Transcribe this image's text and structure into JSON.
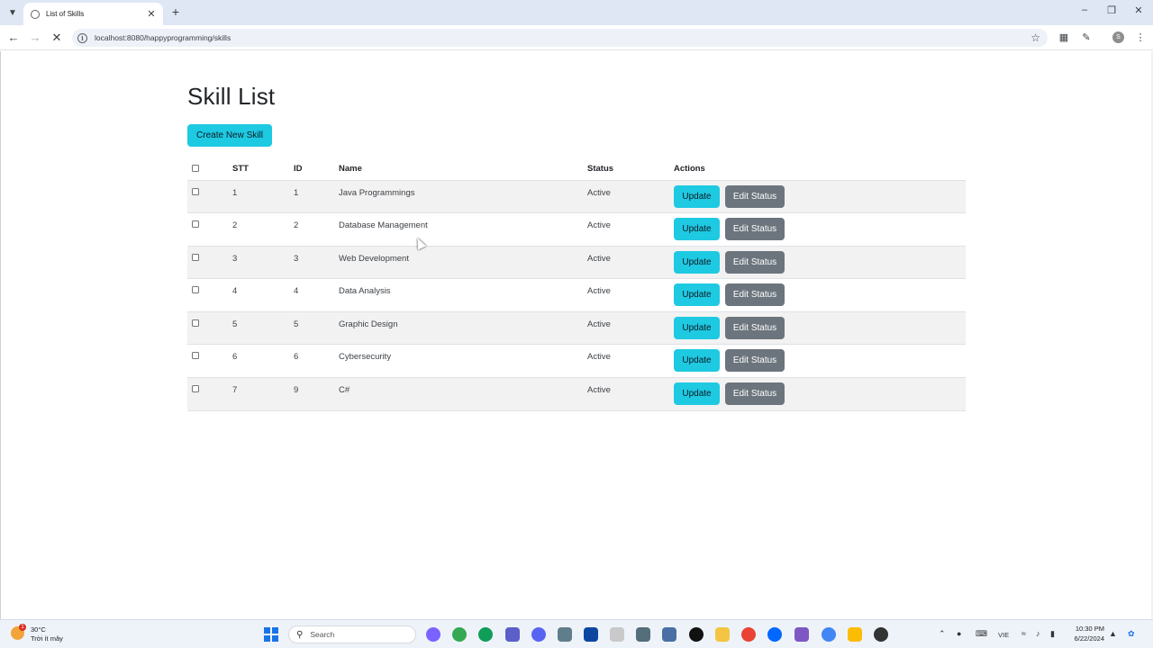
{
  "browser": {
    "tab_title": "List of Skills",
    "url": "localhost:8080/happyprogramming/skills",
    "profile_initial": "S"
  },
  "page": {
    "title": "Skill List",
    "create_button": "Create New Skill",
    "columns": {
      "stt": "STT",
      "id": "ID",
      "name": "Name",
      "status": "Status",
      "actions": "Actions"
    },
    "update_label": "Update",
    "edit_status_label": "Edit Status",
    "rows": [
      {
        "stt": "1",
        "id": "1",
        "name": "Java Programmings",
        "status": "Active"
      },
      {
        "stt": "2",
        "id": "2",
        "name": "Database Management",
        "status": "Active"
      },
      {
        "stt": "3",
        "id": "3",
        "name": "Web Development",
        "status": "Active"
      },
      {
        "stt": "4",
        "id": "4",
        "name": "Data Analysis",
        "status": "Active"
      },
      {
        "stt": "5",
        "id": "5",
        "name": "Graphic Design",
        "status": "Active"
      },
      {
        "stt": "6",
        "id": "6",
        "name": "Cybersecurity",
        "status": "Active"
      },
      {
        "stt": "7",
        "id": "9",
        "name": "C#",
        "status": "Active"
      }
    ]
  },
  "taskbar": {
    "weather_temp": "30°C",
    "weather_desc": "Trời ít mây",
    "weather_badge": "1",
    "search_placeholder": "Search",
    "language": "VIE",
    "time": "10:30 PM",
    "date": "6/22/2024"
  },
  "colors": {
    "primary_button": "#1ec9e2",
    "secondary_button": "#6c757d",
    "stripe": "#f2f2f2"
  }
}
